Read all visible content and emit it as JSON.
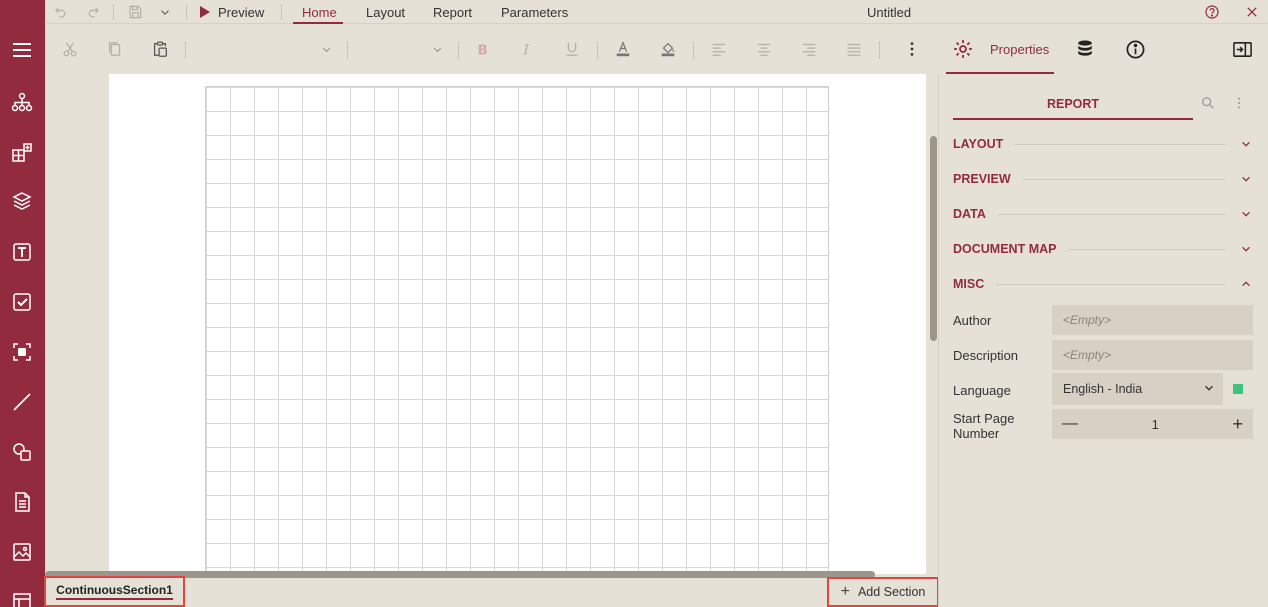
{
  "menu": {
    "preview_label": "Preview",
    "tabs": [
      "Home",
      "Layout",
      "Report",
      "Parameters"
    ],
    "title": "Untitled"
  },
  "panel": {
    "properties_label": "Properties",
    "report_tab": "REPORT",
    "sections": [
      "LAYOUT",
      "PREVIEW",
      "DATA",
      "DOCUMENT MAP",
      "MISC"
    ],
    "props": {
      "author_label": "Author",
      "author_value": "<Empty>",
      "description_label": "Description",
      "description_value": "<Empty>",
      "language_label": "Language",
      "language_value": "English - India",
      "start_page_label_1": "Start Page",
      "start_page_label_2": "Number",
      "start_page_value": "1"
    }
  },
  "bottom": {
    "section_tab": "ContinuousSection1",
    "add_section": "Add Section"
  },
  "colors": {
    "accent": "#922b3e",
    "background": "#e5e1d6",
    "highlight": "#e0453f",
    "language_indicator": "#3cc47c"
  }
}
